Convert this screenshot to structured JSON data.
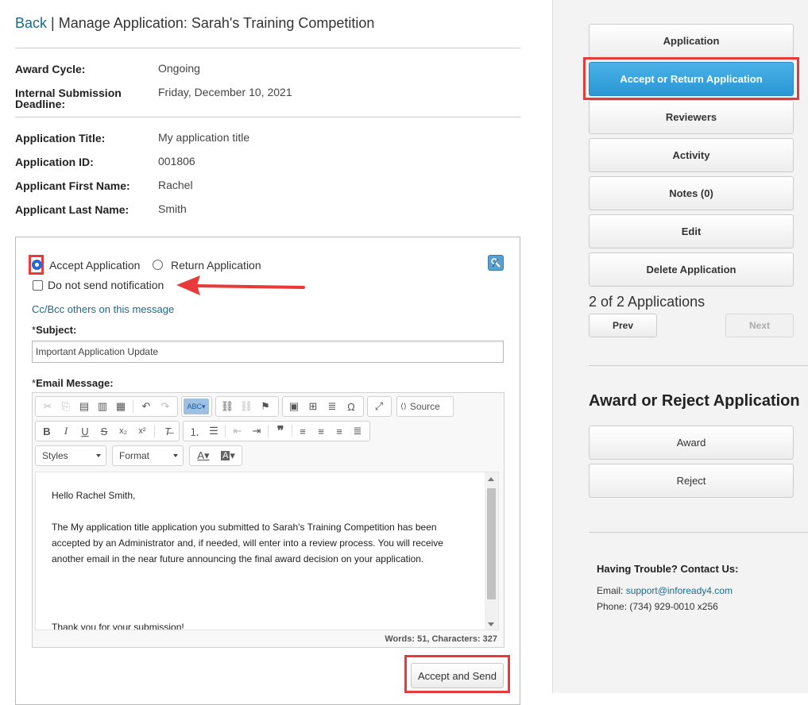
{
  "header": {
    "back_label": "Back",
    "separator": "|",
    "title": "Manage Application: Sarah's Training Competition"
  },
  "award_info": {
    "award_cycle_label": "Award Cycle:",
    "award_cycle_value": "Ongoing",
    "deadline_label_1": "Internal Submission",
    "deadline_label_2": "Deadline:",
    "deadline_value": "Friday, December 10, 2021"
  },
  "application_info": {
    "title_label": "Application Title:",
    "title_value": "My application title",
    "id_label": "Application ID:",
    "id_value": "001806",
    "first_name_label": "Applicant First Name:",
    "first_name_value": "Rachel",
    "last_name_label": "Applicant Last Name:",
    "last_name_value": "Smith"
  },
  "decision_form": {
    "accept_label": "Accept Application",
    "accept_selected": true,
    "return_label": "Return Application",
    "do_not_send_label": "Do not send notification",
    "do_not_send_checked": false,
    "cc_link": "Cc/Bcc others on this message",
    "subject_required": "*",
    "subject_label": "Subject:",
    "subject_value": "Important Application Update",
    "message_required": "*",
    "message_label": "Email Message:",
    "source_label": "Source",
    "styles_label": "Styles",
    "format_label": "Format",
    "message_lines": {
      "greeting": "Hello Rachel Smith,",
      "body": "The My application title application you submitted to Sarah's Training Competition has been accepted by an Administrator and, if needed, will enter into a review process. You will receive another email in the near future announcing the final award decision on your application.",
      "closing": "Thank you for your submission!"
    },
    "word_count": "Words: 51, Characters: 327",
    "submit_label": "Accept and Send"
  },
  "sidebar": {
    "buttons": [
      {
        "label": "Application"
      },
      {
        "label": "Accept or Return Application"
      },
      {
        "label": "Reviewers"
      },
      {
        "label": "Activity"
      },
      {
        "label": "Notes (0)"
      },
      {
        "label": "Edit"
      },
      {
        "label": "Delete Application"
      }
    ],
    "counter": "2 of 2 Applications",
    "prev_label": "Prev",
    "next_label": "Next",
    "award_section_title": "Award or Reject Application",
    "award_label": "Award",
    "reject_label": "Reject",
    "trouble_title": "Having Trouble? Contact Us:",
    "email_label": "Email:",
    "email_value": "support@infoready4.com",
    "phone_label": "Phone:",
    "phone_value": "(734) 929-0010 x256"
  },
  "colors": {
    "primary_button": "#2997d3",
    "highlight_annotation": "#e83a3a",
    "link": "#1a6a8a"
  }
}
